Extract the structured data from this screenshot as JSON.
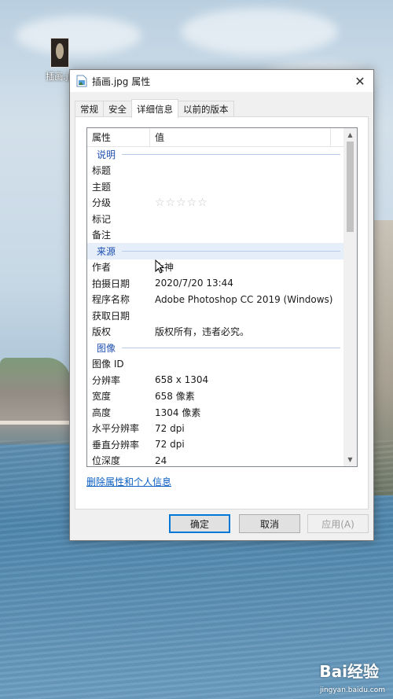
{
  "desktop": {
    "icon_label": "插画.jp"
  },
  "window": {
    "title": "插画.jpg 属性",
    "tabs": [
      {
        "label": "常规"
      },
      {
        "label": "安全"
      },
      {
        "label": "详细信息",
        "active": true
      },
      {
        "label": "以前的版本"
      }
    ],
    "list": {
      "col_property": "属性",
      "col_value": "值",
      "sections": [
        {
          "name": "说明",
          "rows": [
            {
              "k": "标题",
              "v": ""
            },
            {
              "k": "主题",
              "v": ""
            },
            {
              "k": "分级",
              "v": "☆☆☆☆☆"
            },
            {
              "k": "标记",
              "v": ""
            },
            {
              "k": "备注",
              "v": ""
            }
          ]
        },
        {
          "name": "来源",
          "rows": [
            {
              "k": "作者",
              "v": "大神"
            },
            {
              "k": "拍摄日期",
              "v": "2020/7/20 13:44"
            },
            {
              "k": "程序名称",
              "v": "Adobe Photoshop CC 2019 (Windows)"
            },
            {
              "k": "获取日期",
              "v": ""
            },
            {
              "k": "版权",
              "v": "版权所有，违者必究。"
            }
          ]
        },
        {
          "name": "图像",
          "rows": [
            {
              "k": "图像 ID",
              "v": ""
            },
            {
              "k": "分辨率",
              "v": "658 x 1304"
            },
            {
              "k": "宽度",
              "v": "658 像素"
            },
            {
              "k": "高度",
              "v": "1304 像素"
            },
            {
              "k": "水平分辨率",
              "v": "72 dpi"
            },
            {
              "k": "垂直分辨率",
              "v": "72 dpi"
            },
            {
              "k": "位深度",
              "v": "24"
            }
          ]
        }
      ]
    },
    "remove_link": "删除属性和个人信息",
    "buttons": {
      "ok": "确定",
      "cancel": "取消",
      "apply": "应用(A)"
    }
  },
  "watermark": {
    "brand": "Bai经验",
    "url": "jingyan.baidu.com"
  },
  "colors": {
    "accent": "#0078d7",
    "group_header": "#1e4fb0",
    "link": "#0a5ec2"
  }
}
